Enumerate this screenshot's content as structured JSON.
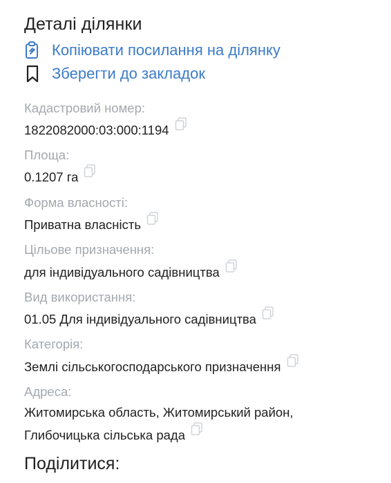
{
  "title": "Деталі ділянки",
  "actions": {
    "copy_link": {
      "label": "Копіювати посилання на ділянку",
      "icon": "clipboard-icon"
    },
    "bookmark": {
      "label": "Зберегти до закладок",
      "icon": "bookmark-icon"
    }
  },
  "fields": {
    "cadastral": {
      "label": "Кадастровий номер:",
      "value": "1822082000:03:000:1194"
    },
    "area": {
      "label": "Площа:",
      "value": "0.1207 га"
    },
    "ownership": {
      "label": "Форма власності:",
      "value": "Приватна власність"
    },
    "purpose": {
      "label": "Цільове призначення:",
      "value": "для індивідуального садівництва"
    },
    "usage": {
      "label": "Вид використання:",
      "value": "01.05 Для індивідуального садівництва"
    },
    "category": {
      "label": "Категорія:",
      "value": "Землі сільськогосподарського призначення"
    },
    "address": {
      "label": "Адреса:",
      "line1": "Житомирська область, Житомирський район,",
      "line2": "Глибочицька сільська рада"
    }
  },
  "share_title": "Поділитися:",
  "colors": {
    "link": "#3b7bc8",
    "label": "#a3a8ae",
    "text": "#1f1f1f",
    "copy_icon": "#d0d3d7"
  }
}
